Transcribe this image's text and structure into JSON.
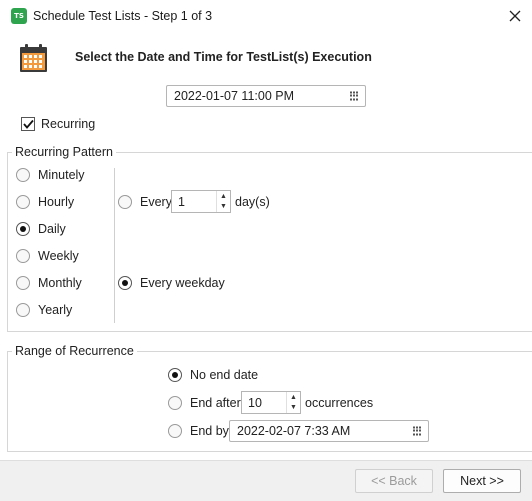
{
  "window": {
    "app_icon_text": "TS",
    "title": "Schedule Test Lists - Step 1 of 3"
  },
  "header": {
    "title": "Select the Date and Time for TestList(s) Execution"
  },
  "start_datetime": {
    "value": "2022-01-07 11:00 PM"
  },
  "recurring": {
    "label": "Recurring",
    "checked": true
  },
  "recurring_pattern": {
    "legend": "Recurring Pattern",
    "options": [
      {
        "label": "Minutely",
        "selected": false
      },
      {
        "label": "Hourly",
        "selected": false
      },
      {
        "label": "Daily",
        "selected": true
      },
      {
        "label": "Weekly",
        "selected": false
      },
      {
        "label": "Monthly",
        "selected": false
      },
      {
        "label": "Yearly",
        "selected": false
      }
    ],
    "every": {
      "label": "Every",
      "value": "1",
      "unit": "day(s)",
      "selected": false
    },
    "every_weekday": {
      "label": "Every weekday",
      "selected": true
    }
  },
  "range": {
    "legend": "Range of Recurrence",
    "no_end_date": {
      "label": "No end date",
      "selected": true
    },
    "end_after": {
      "label": "End after",
      "value": "10",
      "unit": "occurrences",
      "selected": false
    },
    "end_by": {
      "label": "End by",
      "value": "2022-02-07 7:33 AM",
      "selected": false
    }
  },
  "footer": {
    "back_label": "<< Back",
    "next_label": "Next >>"
  }
}
